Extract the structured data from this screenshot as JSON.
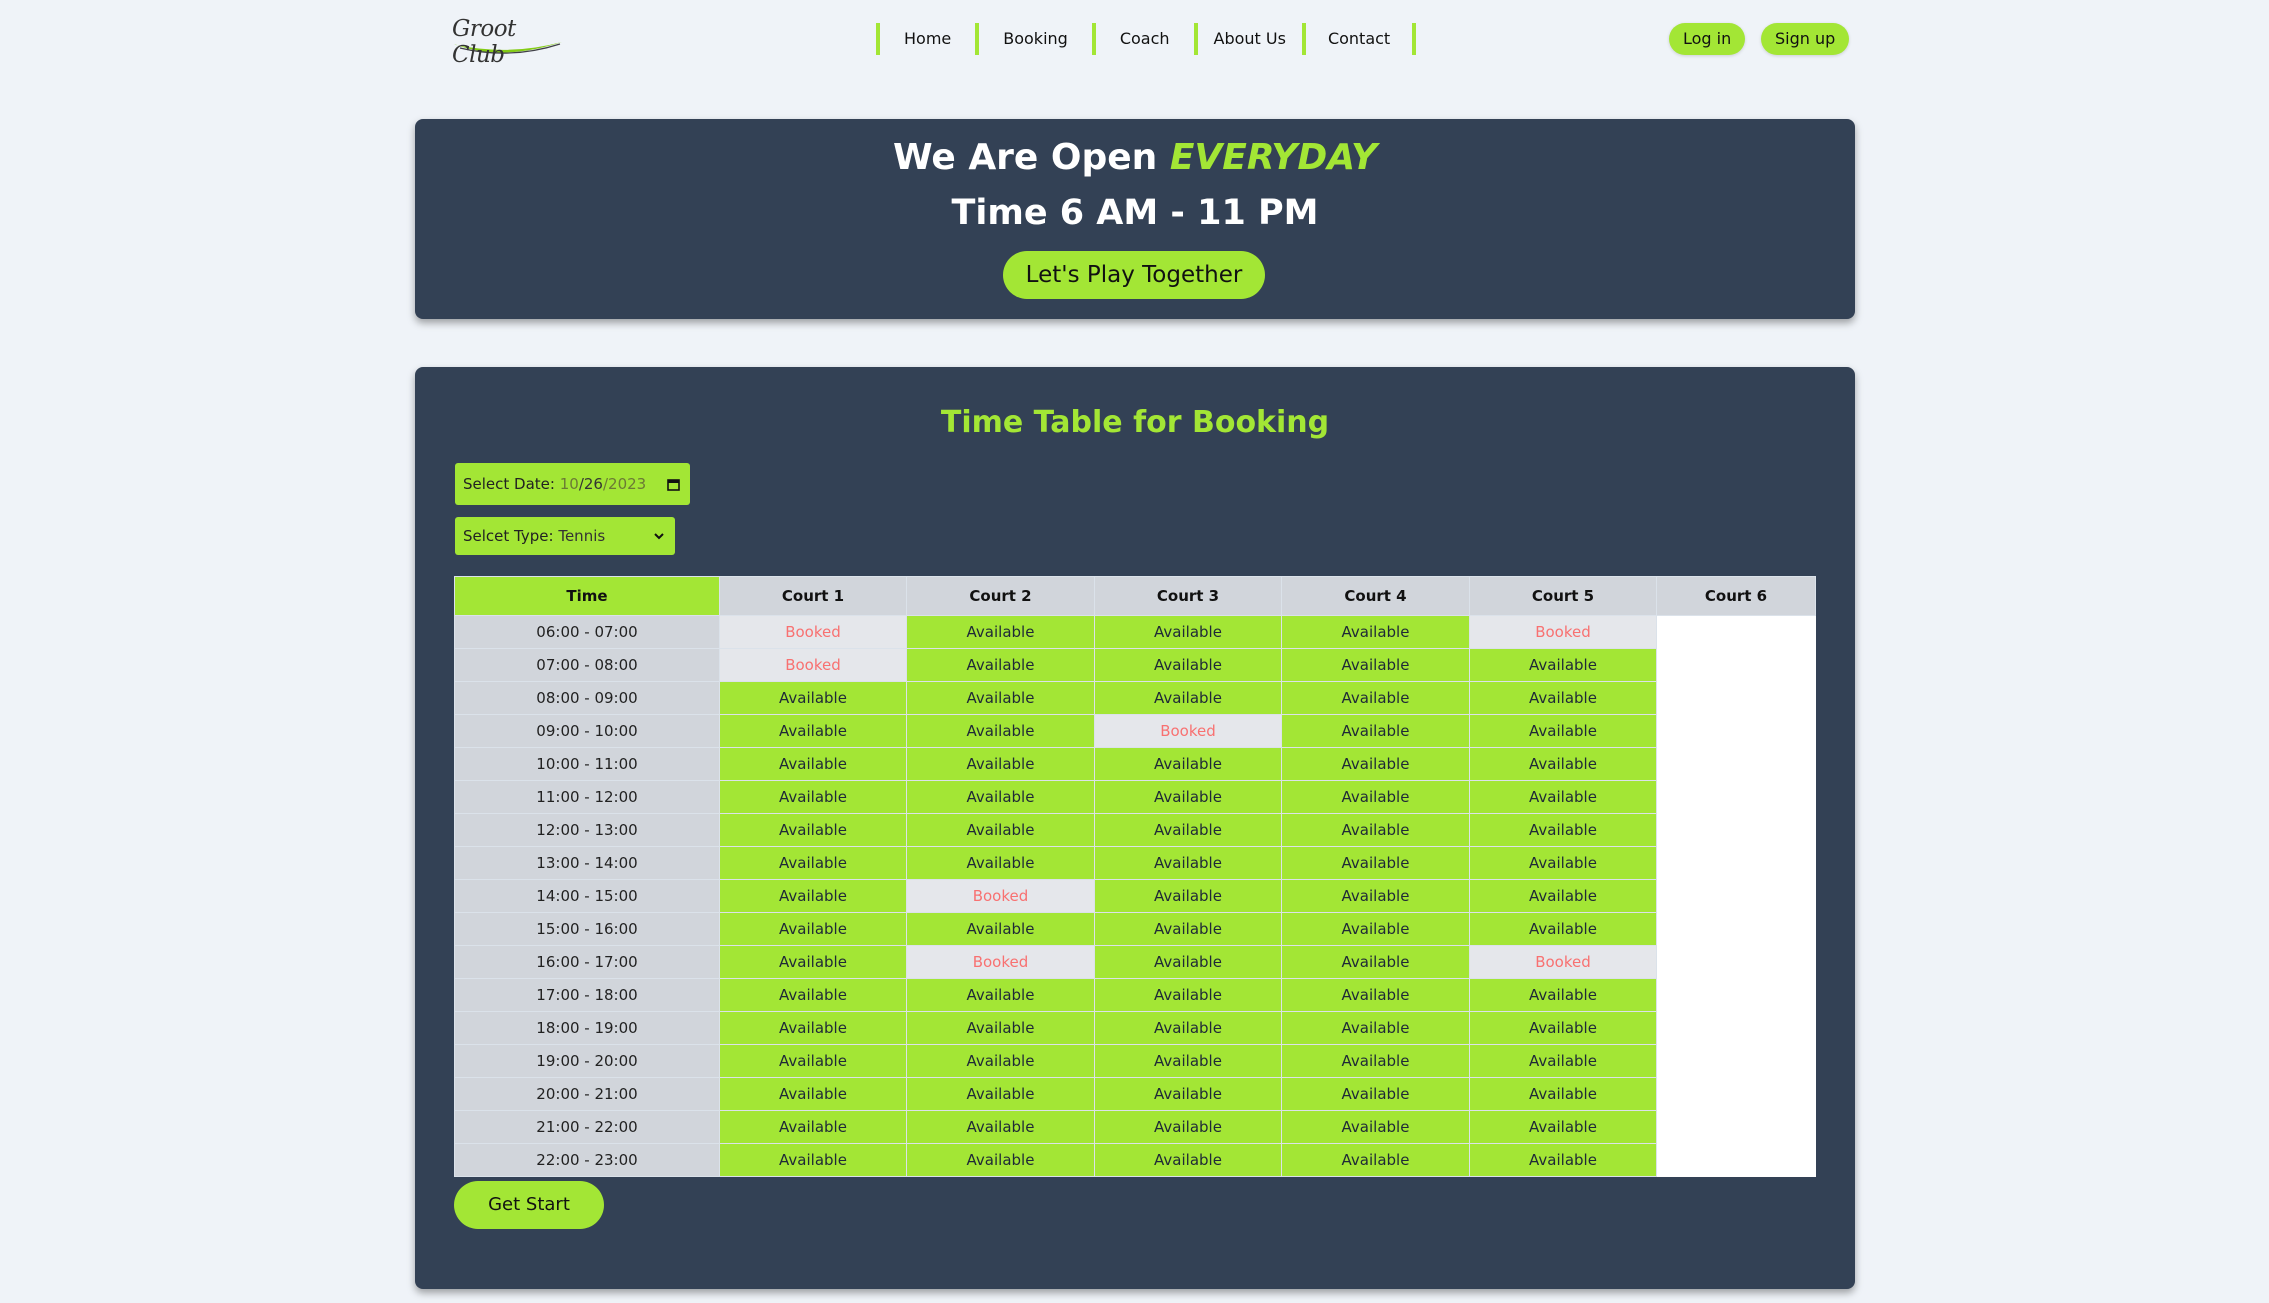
{
  "brand": {
    "logo_text": "Groot Club"
  },
  "nav": {
    "items": [
      {
        "label": "Home"
      },
      {
        "label": "Booking"
      },
      {
        "label": "Coach"
      },
      {
        "label": "About Us"
      },
      {
        "label": "Contact"
      }
    ]
  },
  "auth": {
    "login_label": "Log in",
    "signup_label": "Sign up"
  },
  "hero": {
    "line1_prefix": "We Are Open",
    "line1_emphasis": "EVERYDAY",
    "line2": "Time 6 AM - 11 PM",
    "cta_label": "Let's Play Together"
  },
  "booking": {
    "title": "Time Table for Booking",
    "date_label": "Select Date:",
    "date_month": "10",
    "date_day": "26",
    "date_year": "2023",
    "type_label": "Selcet Type:",
    "type_value": "Tennis",
    "time_header": "Time",
    "courts": [
      "Court 1",
      "Court 2",
      "Court 3",
      "Court 4",
      "Court 5",
      "Court 6"
    ],
    "rows": [
      {
        "time": "06:00 - 07:00",
        "slots": [
          "Booked",
          "Available",
          "Available",
          "Available",
          "Booked",
          ""
        ]
      },
      {
        "time": "07:00 - 08:00",
        "slots": [
          "Booked",
          "Available",
          "Available",
          "Available",
          "Available",
          ""
        ]
      },
      {
        "time": "08:00 - 09:00",
        "slots": [
          "Available",
          "Available",
          "Available",
          "Available",
          "Available",
          ""
        ]
      },
      {
        "time": "09:00 - 10:00",
        "slots": [
          "Available",
          "Available",
          "Booked",
          "Available",
          "Available",
          ""
        ]
      },
      {
        "time": "10:00 - 11:00",
        "slots": [
          "Available",
          "Available",
          "Available",
          "Available",
          "Available",
          ""
        ]
      },
      {
        "time": "11:00 - 12:00",
        "slots": [
          "Available",
          "Available",
          "Available",
          "Available",
          "Available",
          ""
        ]
      },
      {
        "time": "12:00 - 13:00",
        "slots": [
          "Available",
          "Available",
          "Available",
          "Available",
          "Available",
          ""
        ]
      },
      {
        "time": "13:00 - 14:00",
        "slots": [
          "Available",
          "Available",
          "Available",
          "Available",
          "Available",
          ""
        ]
      },
      {
        "time": "14:00 - 15:00",
        "slots": [
          "Available",
          "Booked",
          "Available",
          "Available",
          "Available",
          ""
        ]
      },
      {
        "time": "15:00 - 16:00",
        "slots": [
          "Available",
          "Available",
          "Available",
          "Available",
          "Available",
          ""
        ]
      },
      {
        "time": "16:00 - 17:00",
        "slots": [
          "Available",
          "Booked",
          "Available",
          "Available",
          "Booked",
          ""
        ]
      },
      {
        "time": "17:00 - 18:00",
        "slots": [
          "Available",
          "Available",
          "Available",
          "Available",
          "Available",
          ""
        ]
      },
      {
        "time": "18:00 - 19:00",
        "slots": [
          "Available",
          "Available",
          "Available",
          "Available",
          "Available",
          ""
        ]
      },
      {
        "time": "19:00 - 20:00",
        "slots": [
          "Available",
          "Available",
          "Available",
          "Available",
          "Available",
          ""
        ]
      },
      {
        "time": "20:00 - 21:00",
        "slots": [
          "Available",
          "Available",
          "Available",
          "Available",
          "Available",
          ""
        ]
      },
      {
        "time": "21:00 - 22:00",
        "slots": [
          "Available",
          "Available",
          "Available",
          "Available",
          "Available",
          ""
        ]
      },
      {
        "time": "22:00 - 23:00",
        "slots": [
          "Available",
          "Available",
          "Available",
          "Available",
          "Available",
          ""
        ]
      }
    ],
    "get_start_label": "Get Start"
  },
  "colors": {
    "accent": "#a3e635",
    "panel": "#334155",
    "page": "#eff3f8",
    "booked_text": "#f87171"
  },
  "icons": {
    "date": "calendar-icon",
    "select": "chevron-down-icon"
  }
}
